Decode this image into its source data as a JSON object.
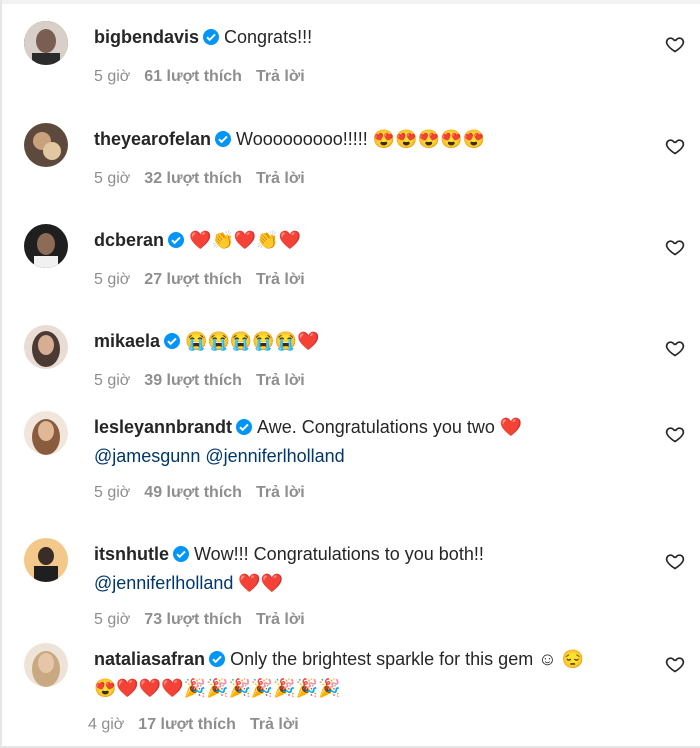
{
  "comments": [
    {
      "username": "bigbendavis",
      "text": "Congrats!!!",
      "mentions": "",
      "emoji": "",
      "emoji2": "",
      "time": "5 giờ",
      "likes": "61 lượt thích",
      "reply": "Trả lời",
      "avatar_color": "#5b4b49"
    },
    {
      "username": "theyearofelan",
      "text": "Wooooooooo!!!!!",
      "mentions": "",
      "emoji": "😍😍😍😍😍",
      "emoji2": "",
      "time": "5 giờ",
      "likes": "32 lượt thích",
      "reply": "Trả lời",
      "avatar_color": "#8a6a55"
    },
    {
      "username": "dcberan",
      "text": "",
      "mentions": "",
      "emoji": "❤️👏❤️👏❤️",
      "emoji2": "",
      "time": "5 giờ",
      "likes": "27 lượt thích",
      "reply": "Trả lời",
      "avatar_color": "#2a2a2a"
    },
    {
      "username": "mikaela",
      "text": "",
      "mentions": "",
      "emoji": "😭😭😭😭😭❤️",
      "emoji2": "",
      "time": "5 giờ",
      "likes": "39 lượt thích",
      "reply": "Trả lời",
      "avatar_color": "#6b5a52"
    },
    {
      "username": "lesleyannbrandt",
      "text": "Awe. Congratulations you two",
      "mentions": "@jamesgunn @jenniferlholland",
      "emoji": "❤️",
      "emoji2": "",
      "time": "5 giờ",
      "likes": "49 lượt thích",
      "reply": "Trả lời",
      "avatar_color": "#b08a6a"
    },
    {
      "username": "itsnhutle",
      "text": "Wow!!! Congratulations to you both!!",
      "mentions": "@jenniferlholland",
      "emoji": "",
      "emoji2": "❤️❤️",
      "time": "5 giờ",
      "likes": "73 lượt thích",
      "reply": "Trả lời",
      "avatar_color": "#4a3b33"
    },
    {
      "username": "nataliasafran",
      "text": "Only the brightest sparkle for this gem ☺",
      "mentions": "",
      "emoji": "😔",
      "emoji2": "😍❤️❤️❤️🎉🎉🎉🎉🎉🎉🎉",
      "time": "4 giờ",
      "likes": "17 lượt thích",
      "reply": "Trả lời",
      "avatar_color": "#c9a982"
    }
  ],
  "colors": {
    "text": "#262626",
    "meta": "#8e8e8e",
    "mention": "#00376b",
    "verified": "#0095f6"
  }
}
